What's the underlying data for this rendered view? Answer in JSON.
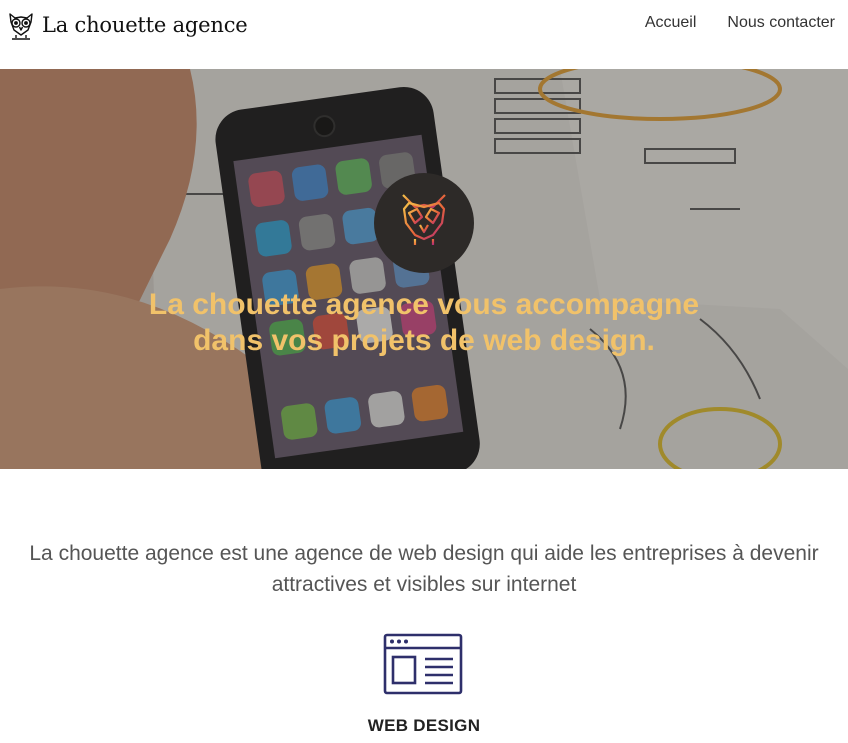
{
  "header": {
    "brand_name": "La chouette agence",
    "nav": [
      {
        "label": "Accueil"
      },
      {
        "label": "Nous contacter"
      }
    ]
  },
  "hero": {
    "title_line1": "La chouette agence vous accompagne",
    "title_line2": "dans vos projets de web design.",
    "badge_icon": "owl-logo-icon",
    "title_color": "#f1c26a"
  },
  "intro": {
    "line1": "La chouette agence est une agence de web design qui aide les entreprises à devenir",
    "line2": "attractives et visibles sur internet"
  },
  "services": [
    {
      "title": "WEB DESIGN",
      "icon": "browser-window-icon",
      "icon_color": "#2e2f6b"
    }
  ]
}
